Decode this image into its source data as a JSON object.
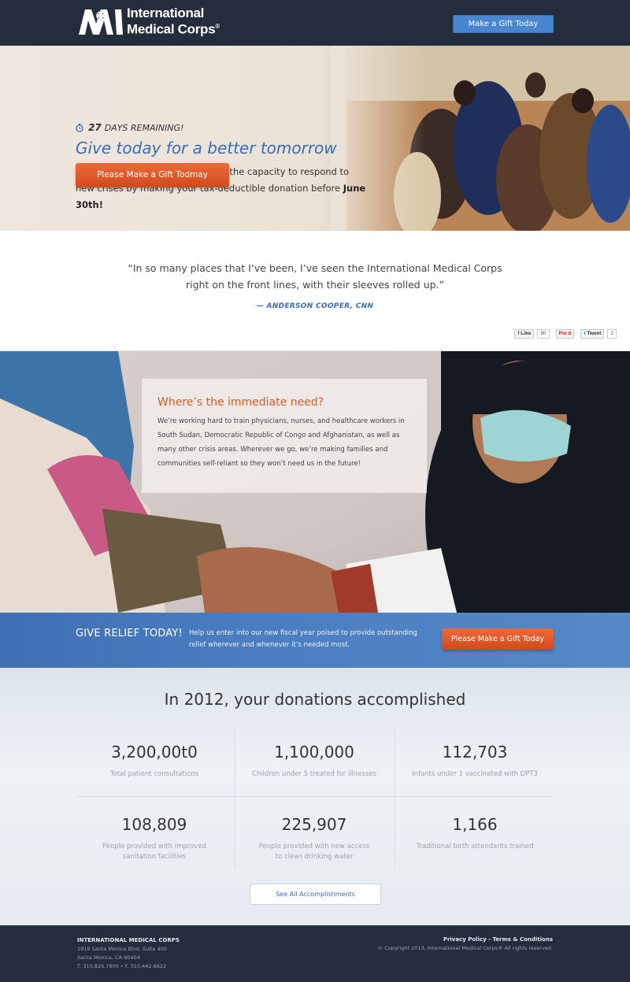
{
  "header": {
    "logo_line1": "International",
    "logo_line2": "Medical Corps",
    "logo_reg": "®",
    "cta_label": "Make a Gift Today"
  },
  "hero": {
    "days_count": "27",
    "days_text": "DAYS REMAINING!",
    "title": "Give today for a better tomorrow",
    "body_text": "Launch us into our new year with the capacity to respond to new crises by making your tax-deductible donation before ",
    "body_bold": "June 30th!",
    "cta_label": "Please Make a Gift Todmay",
    "clock_icon": "clock-icon"
  },
  "quote": {
    "text": "“In so many places that I’ve been, I’ve seen the International Medical Corps right on the front lines, with their sleeves rolled up.”",
    "author": "— ANDERSON COOPER, CNN",
    "social": {
      "like_label": "Like",
      "like_count": "80",
      "pin_label": "Pin it",
      "tweet_label": "Tweet",
      "tweet_count": "2"
    }
  },
  "need": {
    "title": "Where’s the immediate need?",
    "body": "We’re working hard to train physicians, nurses, and healthcare workers in South Sudan, Democratic Republic of Congo and Afghanistan, as well as many other crisis areas. Wherever we go, we’re making families and communities self-reliant so they won’t need us in the future!"
  },
  "relief": {
    "title": "GIVE RELIEF TODAY!",
    "body": "Help us enter into our new fiscal year poised to provide outstanding relief wherever and whenever it’s needed most.",
    "cta_label": "Please Make a Gift Today"
  },
  "accomplishments": {
    "title": "In 2012, your donations accomplished",
    "stats": [
      {
        "value": "3,200,00t0",
        "label": "Total patient consultations"
      },
      {
        "value": "1,100,000",
        "label": "Children under 5 treated for illnesses"
      },
      {
        "value": "112,703",
        "label": "Infants under 1 vaccinated with DPT3"
      },
      {
        "value": "108,809",
        "label": "People provided with improved sanitation facilities"
      },
      {
        "value": "225,907",
        "label": "People provided with new access to clean drinking water"
      },
      {
        "value": "1,166",
        "label": "Traditional birth attendants trained"
      }
    ],
    "see_all_label": "See All Accomplishments"
  },
  "footer": {
    "org": "INTERNATIONAL MEDICAL CORPS",
    "address1": "1919 Santa Monica Blvd. Suite 400",
    "address2": "Santa Monica, CA 90404",
    "phone": "T. 310.826.7800 • F. 310.442.6622",
    "privacy": "Privacy Policy",
    "separator": " - ",
    "terms": "Terms & Conditions",
    "copyright": "© Copyright 2013, International Medical Corps® All rights reserved."
  },
  "colors": {
    "header_bg": "#232d3d",
    "accent_blue": "#3a6db5",
    "cta_orange": "#e05a2b"
  }
}
